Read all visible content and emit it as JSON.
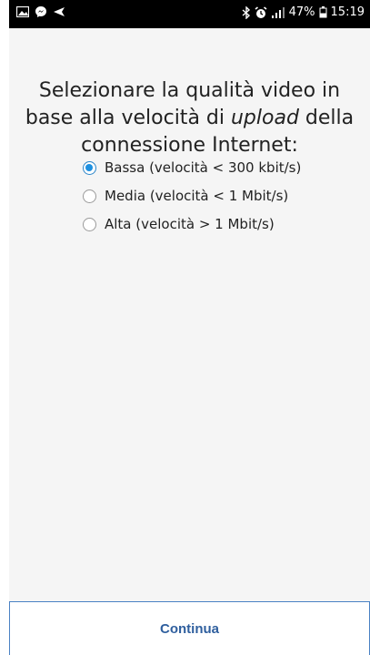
{
  "status_bar": {
    "left_icons": [
      "image-icon",
      "messenger-icon",
      "navigation-icon"
    ],
    "right_icons": [
      "bluetooth-icon",
      "alarm-icon",
      "signal-icon"
    ],
    "battery_percent": "47%",
    "battery_icon": "battery-icon",
    "time": "15:19"
  },
  "prompt": {
    "line1": "Selezionare la qualità video in",
    "line2_before": "base alla velocità di ",
    "line2_em": "upload",
    "line2_after": " della",
    "line3": "connessione Internet:"
  },
  "options": [
    {
      "label": "Bassa (velocità < 300 kbit/s)",
      "selected": true
    },
    {
      "label": "Media (velocità < 1 Mbit/s)",
      "selected": false
    },
    {
      "label": "Alta (velocità > 1 Mbit/s)",
      "selected": false
    }
  ],
  "continue_button": {
    "label": "Continua"
  },
  "colors": {
    "accent": "#1e90e0",
    "button_text": "#2f5f9e",
    "button_border": "#4a82c4",
    "background": "#f5f5f5",
    "status_bar": "#000000"
  }
}
